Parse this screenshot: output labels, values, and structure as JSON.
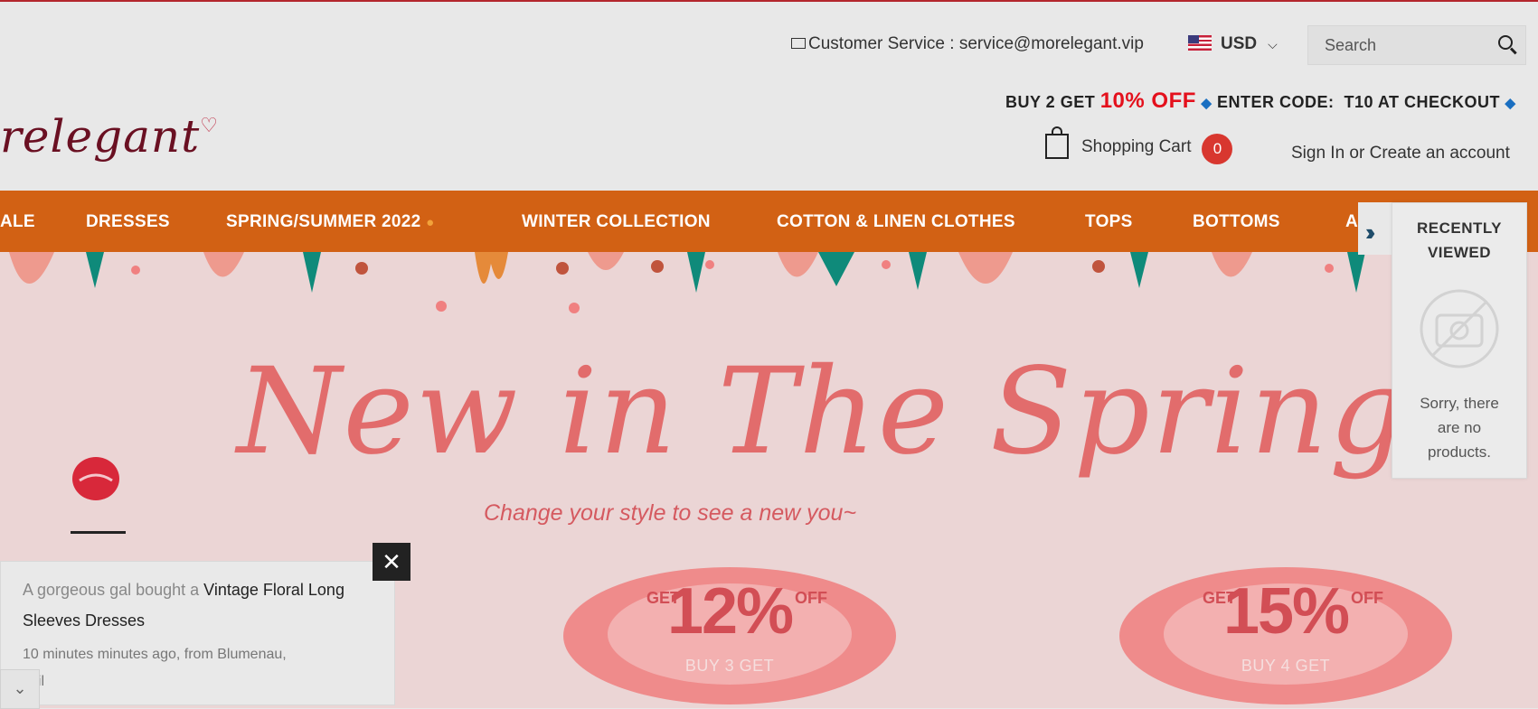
{
  "header": {
    "customer_service": "Customer Service : service@morelegant.vip",
    "currency": "USD",
    "search_placeholder": "Search",
    "logo_text": "relegant",
    "promo": {
      "part1": "BUY 2 GET ",
      "highlight": "10% OFF",
      "part2": "ENTER CODE:",
      "code": "T10 AT CHECKOUT"
    },
    "cart_label": "Shopping Cart",
    "cart_count": "0",
    "signin": "Sign In or Create an account"
  },
  "nav": {
    "items": [
      "ALE",
      "DRESSES",
      "SPRING/SUMMER 2022",
      "WINTER COLLECTION",
      "COTTON & LINEN CLOTHES",
      "TOPS",
      "BOTTOMS",
      "A"
    ]
  },
  "hero": {
    "headline": "New in The Spring",
    "subheadline": "Change your style to see a new you~",
    "badges": [
      {
        "pct": "12%",
        "left": "GET",
        "right": "OFF",
        "buy": "BUY 3 GET"
      },
      {
        "pct": "15%",
        "left": "GET",
        "right": "OFF",
        "buy": "BUY 4 GET"
      }
    ]
  },
  "recently_viewed": {
    "title_line1": "RECENTLY",
    "title_line2": "VIEWED",
    "empty_line1": "Sorry, there",
    "empty_line2": "are no",
    "empty_line3": "products."
  },
  "notification": {
    "prefix": "A gorgeous gal bought a ",
    "product": "Vintage Floral Long Sleeves Dresses",
    "line2": "10 minutes minutes ago, from Blumenau,",
    "line3": "azil"
  },
  "colors": {
    "nav": "#d26114",
    "promo_red": "#e4101c",
    "cart_badge": "#d8372f",
    "hero_bg": "#ebd5d5",
    "headline": "#e26c6c"
  },
  "icons": [
    "mail-icon",
    "us-flag-icon",
    "chevron-down-icon",
    "search-icon",
    "shopping-bag-icon",
    "double-chevron-right-icon",
    "no-image-camera-icon",
    "close-icon",
    "lips-icon"
  ]
}
